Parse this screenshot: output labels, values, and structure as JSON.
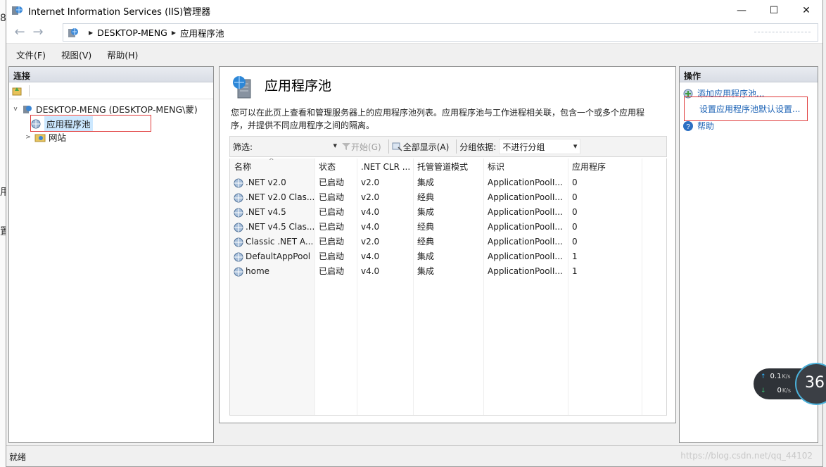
{
  "window": {
    "title": "Internet Information Services (IIS)管理器",
    "minimize": "—",
    "maximize": "☐",
    "close": "✕"
  },
  "edge_text": [
    "8",
    "用",
    "置"
  ],
  "nav": {
    "back": "←",
    "forward": "→",
    "breadcrumbs": [
      "DESKTOP-MENG",
      "应用程序池"
    ],
    "separator": "▶"
  },
  "menu": [
    "文件(F)",
    "视图(V)",
    "帮助(H)"
  ],
  "connections": {
    "header": "连接",
    "tree": {
      "server": "DESKTOP-MENG (DESKTOP-MENG\\蒙)",
      "app_pools": "应用程序池",
      "sites": "网站",
      "expanded": "v",
      "collapsed": ">"
    }
  },
  "center": {
    "title": "应用程序池",
    "description": "您可以在此页上查看和管理服务器上的应用程序池列表。应用程序池与工作进程相关联，包含一个或多个应用程序，并提供不同应用程序之间的隔离。",
    "filter": {
      "label": "筛选:",
      "start": "开始(G)",
      "show_all": "全部显示(A)",
      "group_by_label": "分组依据:",
      "group_by_value": "不进行分组"
    },
    "columns": [
      "名称",
      "状态",
      ".NET CLR ...",
      "托管管道模式",
      "标识",
      "应用程序"
    ],
    "sort_arrow": "^",
    "rows": [
      {
        "name": ".NET v2.0",
        "status": "已启动",
        "clr": "v2.0",
        "pipeline": "集成",
        "identity": "ApplicationPoolI...",
        "apps": "0"
      },
      {
        "name": ".NET v2.0 Clas...",
        "status": "已启动",
        "clr": "v2.0",
        "pipeline": "经典",
        "identity": "ApplicationPoolI...",
        "apps": "0"
      },
      {
        "name": ".NET v4.5",
        "status": "已启动",
        "clr": "v4.0",
        "pipeline": "集成",
        "identity": "ApplicationPoolI...",
        "apps": "0"
      },
      {
        "name": ".NET v4.5 Clas...",
        "status": "已启动",
        "clr": "v4.0",
        "pipeline": "经典",
        "identity": "ApplicationPoolI...",
        "apps": "0"
      },
      {
        "name": "Classic .NET A...",
        "status": "已启动",
        "clr": "v2.0",
        "pipeline": "经典",
        "identity": "ApplicationPoolI...",
        "apps": "0"
      },
      {
        "name": "DefaultAppPool",
        "status": "已启动",
        "clr": "v4.0",
        "pipeline": "集成",
        "identity": "ApplicationPoolI...",
        "apps": "1"
      },
      {
        "name": "home",
        "status": "已启动",
        "clr": "v4.0",
        "pipeline": "集成",
        "identity": "ApplicationPoolI...",
        "apps": "1"
      }
    ]
  },
  "actions": {
    "header": "操作",
    "items": [
      "添加应用程序池...",
      "设置应用程序池默认设置...",
      "帮助"
    ]
  },
  "status": {
    "text": "就绪",
    "watermark": "https://blog.csdn.net/qq_44102"
  },
  "net_monitor": {
    "up_value": "0.1",
    "up_unit": "K/s",
    "down_value": "0",
    "down_unit": "K/s",
    "up_arrow": "↑",
    "down_arrow": "↓",
    "gauge": "36"
  },
  "colors": {
    "link": "#1b62b5",
    "selection": "#cce8ff",
    "highlight_box": "#e03a3a"
  }
}
